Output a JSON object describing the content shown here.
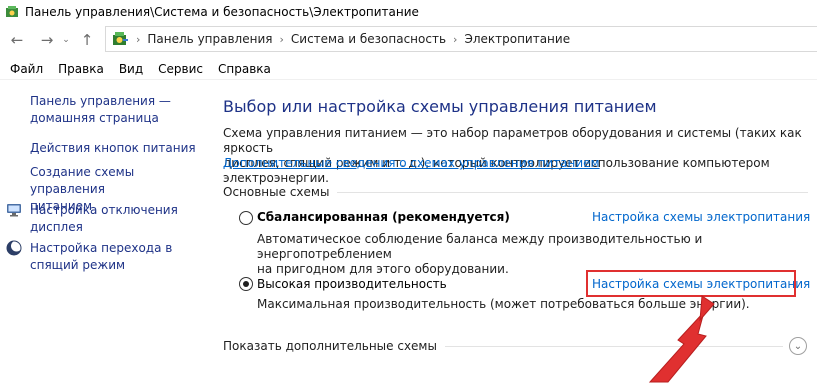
{
  "window": {
    "title": "Панель управления\\Система и безопасность\\Электропитание"
  },
  "navigation": {
    "back_icon": "arrow-left-icon",
    "forward_icon": "arrow-right-icon",
    "recent_icon": "chevron-down-icon",
    "up_icon": "arrow-up-icon",
    "breadcrumbs": [
      "Панель управления",
      "Система и безопасность",
      "Электропитание"
    ]
  },
  "menu": {
    "items": [
      "Файл",
      "Правка",
      "Вид",
      "Сервис",
      "Справка"
    ]
  },
  "sidebar": {
    "home_line1": "Панель управления —",
    "home_line2": "домашняя страница",
    "links": [
      {
        "lines": [
          "Действия кнопок питания"
        ]
      },
      {
        "lines": [
          "Создание схемы управления",
          "питанием"
        ]
      },
      {
        "lines": [
          "Настройка отключения",
          "дисплея"
        ],
        "icon": "monitor-icon"
      },
      {
        "lines": [
          "Настройка перехода в",
          "спящий режим"
        ],
        "icon": "moon-icon"
      }
    ]
  },
  "main": {
    "title": "Выбор или настройка схемы управления питанием",
    "intro_line1": "Схема управления питанием — это набор параметров оборудования и системы (таких как яркость",
    "intro_line2": "дисплея, спящий режим и т. д.), который контролирует использование компьютером электроэнергии.",
    "more_link": "Дополнительные сведения о схемах управления питанием",
    "group_label": "Основные схемы",
    "plans": [
      {
        "name": "Сбалансированная (рекомендуется)",
        "selected": false,
        "desc_line1": "Автоматическое соблюдение баланса между производительностью и энергопотреблением",
        "desc_line2": "на пригодном для этого оборудовании.",
        "link": "Настройка схемы электропитания"
      },
      {
        "name": "Высокая производительность",
        "selected": true,
        "desc_line1": "Максимальная производительность (может потребоваться больше энергии).",
        "link": "Настройка схемы электропитания"
      }
    ],
    "show_more": "Показать дополнительные схемы"
  },
  "annotation": {
    "highlight_color": "#e03030",
    "arrow_color": "#e03030"
  }
}
